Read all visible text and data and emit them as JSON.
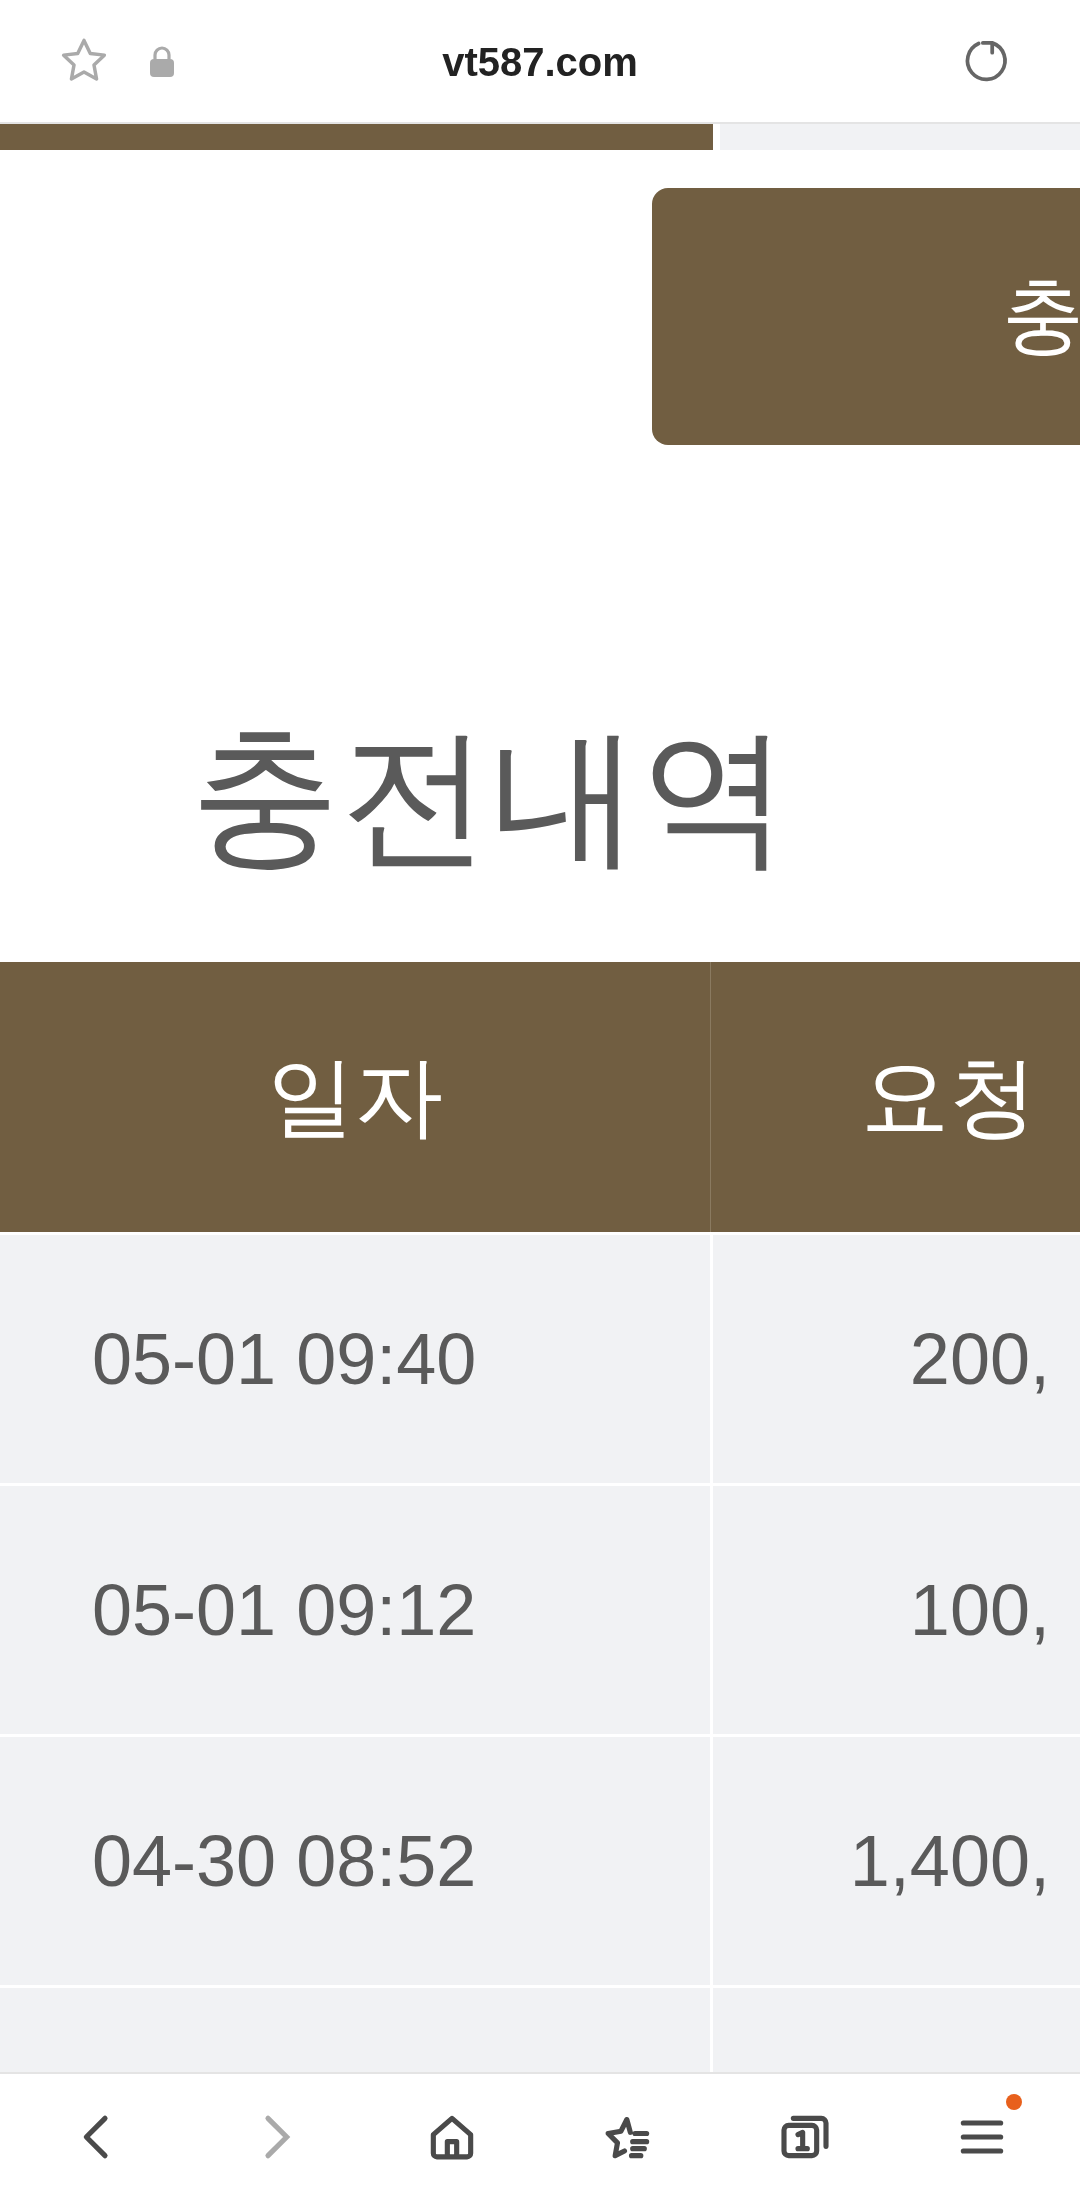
{
  "browser": {
    "url": "vt587.com"
  },
  "top_tabs": [
    {
      "selected": true
    },
    {
      "selected": false
    }
  ],
  "action_button": {
    "label": "충"
  },
  "title": "충전내역",
  "table": {
    "columns": [
      "일자",
      "요청"
    ],
    "rows": [
      {
        "date": "05-01 09:40",
        "amount": "200,"
      },
      {
        "date": "05-01 09:12",
        "amount": "100,"
      },
      {
        "date": "04-30 08:52",
        "amount": "1,400,"
      }
    ]
  },
  "nav": {
    "notification": true
  }
}
